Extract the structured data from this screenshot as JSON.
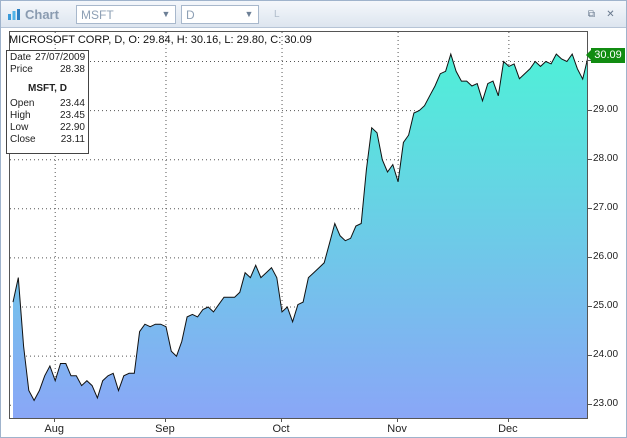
{
  "window": {
    "title": "Chart",
    "symbol_combo": "MSFT",
    "period_combo": "D",
    "timeframe_label": "L",
    "restore_glyph": "⧉",
    "close_glyph": "✕",
    "dropdown_glyph": "▼"
  },
  "chart_header": {
    "text": "MICROSOFT CORP, D, O: 29.84, H: 30.16, L: 29.80, C: 30.09"
  },
  "info_box": {
    "date_label": "Date",
    "date_value": "27/07/2009",
    "price_label": "Price",
    "price_value": "28.38",
    "symbol": "MSFT, D",
    "rows": [
      {
        "label": "Open",
        "value": "23.44"
      },
      {
        "label": "High",
        "value": "23.45"
      },
      {
        "label": "Low",
        "value": "22.90"
      },
      {
        "label": "Close",
        "value": "23.11"
      }
    ]
  },
  "last_price": "30.09",
  "colors": {
    "area_top": "#4ff0d8",
    "area_bottom": "#8aa6f7",
    "line": "#111111",
    "grid": "#555555",
    "last_price_bg": "#118c11"
  },
  "chart_data": {
    "type": "area",
    "title": "",
    "xlabel": "",
    "ylabel": "",
    "ylim": [
      22.7,
      30.6
    ],
    "y_ticks": [
      "23.00",
      "24.00",
      "25.00",
      "26.00",
      "27.00",
      "28.00",
      "29.00",
      "30.00"
    ],
    "x_ticks": [
      "Aug",
      "Sep",
      "Oct",
      "Nov",
      "Dec"
    ],
    "x_tick_index": [
      8,
      29,
      51,
      73,
      94
    ],
    "grid": true,
    "series": [
      {
        "values": [
          25.1,
          25.6,
          24.2,
          23.3,
          23.1,
          23.3,
          23.6,
          23.8,
          23.5,
          23.85,
          23.85,
          23.6,
          23.6,
          23.4,
          23.5,
          23.4,
          23.15,
          23.5,
          23.6,
          23.65,
          23.3,
          23.6,
          23.65,
          23.65,
          24.5,
          24.65,
          24.6,
          24.65,
          24.65,
          24.6,
          24.1,
          24.0,
          24.3,
          24.8,
          24.85,
          24.8,
          24.95,
          25.0,
          24.9,
          25.05,
          25.2,
          25.2,
          25.2,
          25.3,
          25.7,
          25.6,
          25.85,
          25.6,
          25.7,
          25.8,
          25.6,
          24.9,
          25.0,
          24.7,
          25.05,
          25.1,
          25.6,
          25.7,
          25.8,
          25.9,
          26.3,
          26.7,
          26.45,
          26.35,
          26.4,
          26.65,
          26.7,
          27.8,
          28.65,
          28.55,
          28.0,
          27.75,
          27.9,
          27.55,
          28.35,
          28.5,
          28.95,
          29.0,
          29.1,
          29.3,
          29.5,
          29.75,
          29.8,
          30.15,
          29.8,
          29.6,
          29.6,
          29.5,
          29.55,
          29.2,
          29.55,
          29.6,
          29.3,
          30.0,
          29.9,
          29.95,
          29.65,
          29.75,
          29.85,
          30.0,
          29.9,
          30.0,
          29.95,
          30.15,
          30.05,
          30.0,
          30.15,
          29.85,
          29.64,
          30.09
        ]
      }
    ]
  }
}
